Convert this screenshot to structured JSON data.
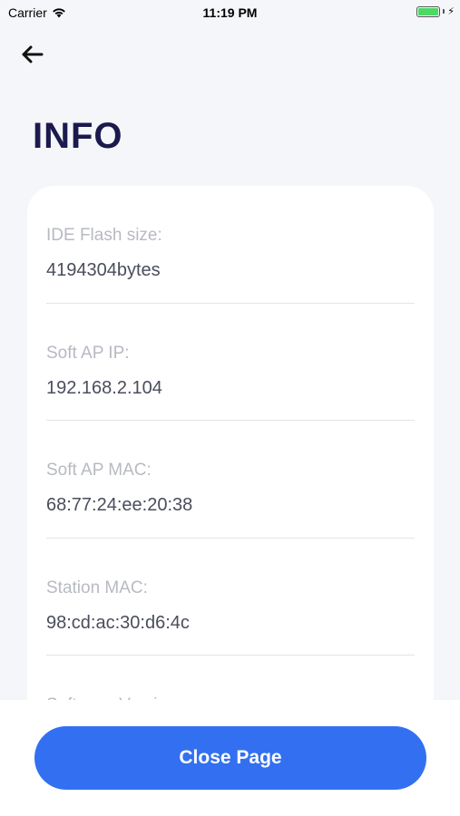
{
  "status_bar": {
    "carrier": "Carrier",
    "time": "11:19 PM",
    "battery_level": 1.0,
    "battery_color": "#4cd964"
  },
  "header": {
    "back_icon": "arrow-left-icon",
    "title": "INFO"
  },
  "info_items": [
    {
      "label": "IDE Flash size:",
      "value": "4194304bytes"
    },
    {
      "label": "Soft AP IP:",
      "value": "192.168.2.104"
    },
    {
      "label": "Soft AP MAC:",
      "value": "68:77:24:ee:20:38"
    },
    {
      "label": "Station MAC:",
      "value": "98:cd:ac:30:d6:4c"
    },
    {
      "label": "Software Version:",
      "value": ""
    }
  ],
  "footer": {
    "close_label": "Close Page",
    "accent_color": "#3370f1"
  }
}
